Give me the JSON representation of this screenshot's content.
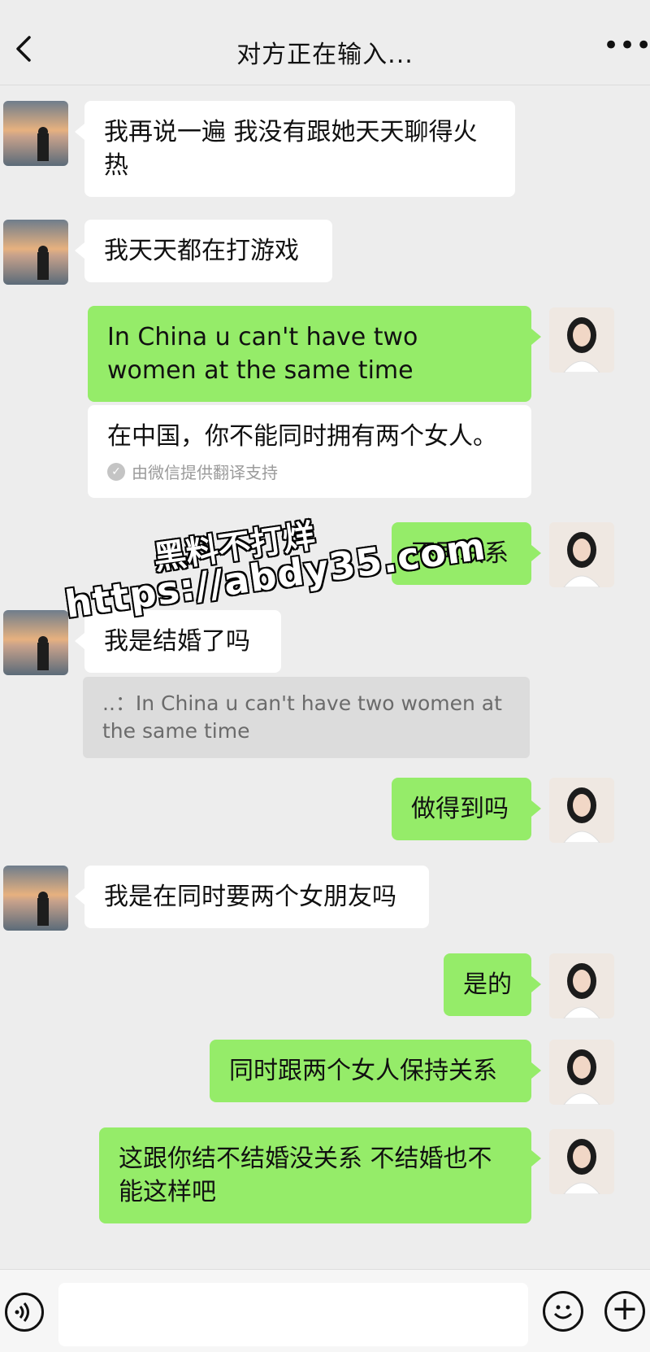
{
  "header": {
    "title": "对方正在输入..."
  },
  "messages": [
    {
      "side": "in",
      "text": "我再说一遍 我没有跟她天天聊得火热"
    },
    {
      "side": "in",
      "text": "我天天都在打游戏"
    },
    {
      "side": "out",
      "text": "In China u can't have two women at the same time"
    },
    {
      "translation": "在中国，你不能同时拥有两个女人。",
      "note": "由微信提供翻译支持"
    },
    {
      "side": "out",
      "text": "不再联系"
    },
    {
      "side": "in",
      "text": "我是结婚了吗"
    },
    {
      "quote": "..：In China u can't have two women at the same time"
    },
    {
      "side": "out",
      "text": "做得到吗"
    },
    {
      "side": "in",
      "text": "我是在同时要两个女朋友吗"
    },
    {
      "side": "out",
      "text": "是的"
    },
    {
      "side": "out",
      "text": "同时跟两个女人保持关系"
    },
    {
      "side": "out",
      "text": "这跟你结不结婚没关系 不结婚也不能这样吧"
    }
  ],
  "watermark": {
    "line1": "黑料不打烊",
    "line2": "https://abdy35.com"
  },
  "colors": {
    "outgoing_bubble": "#95ec69",
    "incoming_bubble": "#ffffff",
    "background": "#ededed"
  }
}
